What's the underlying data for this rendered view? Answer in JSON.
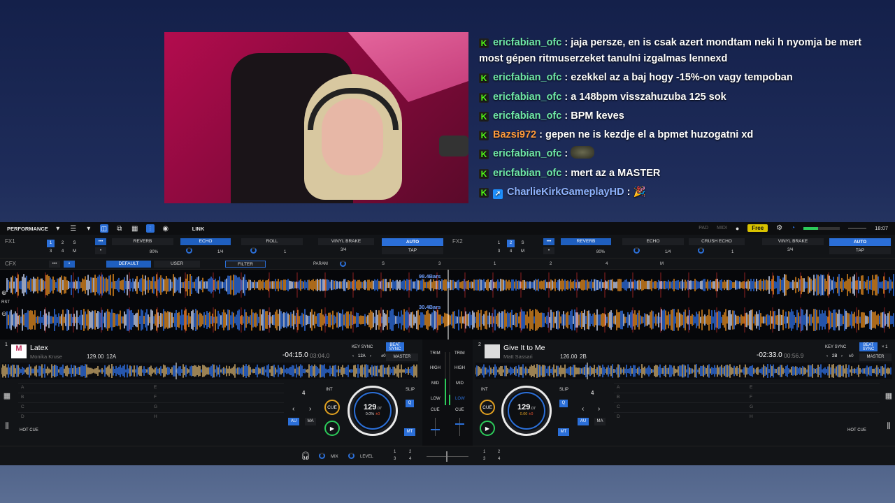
{
  "chat": [
    {
      "user": "ericfabian_ofc",
      "badge": "K",
      "text": "jaja persze, en is csak azert mondtam neki h nyomja be mert most gépen ritmuserzeket tanulni izgalmas lennexd",
      "color": "green"
    },
    {
      "user": "ericfabian_ofc",
      "badge": "K",
      "text": "ezekkel az a baj hogy -15%-on vagy tempoban",
      "color": "green"
    },
    {
      "user": "ericfabian_ofc",
      "badge": "K",
      "text": "a 148bpm visszahuzuba 125 sok",
      "color": "green"
    },
    {
      "user": "ericfabian_ofc",
      "badge": "K",
      "text": "BPM keves",
      "color": "green"
    },
    {
      "user": "Bazsi972",
      "badge": "K",
      "text": "gepen ne is kezdje el a bpmet huzogatni xd",
      "color": "orange"
    },
    {
      "user": "ericfabian_ofc",
      "badge": "K",
      "text": "",
      "color": "green",
      "emote": true
    },
    {
      "user": "ericfabian_ofc",
      "badge": "K",
      "text": "mert az a MASTER",
      "color": "green"
    },
    {
      "user": "CharlieKirkGameplayHD",
      "badge": "K",
      "text": "🎉",
      "color": "blue",
      "badge2": true
    }
  ],
  "topbar": {
    "mode": "PERFORMANCE",
    "link": "LINK",
    "pad": "PAD",
    "midi": "MIDI",
    "free": "Free",
    "clock": "18:07"
  },
  "fx": {
    "fx1": {
      "label": "FX1",
      "nums": [
        "1",
        "2",
        "S",
        "3",
        "4",
        "M"
      ],
      "effects": [
        "REVERB",
        "ECHO",
        "ROLL",
        "VINYL BRAKE"
      ],
      "pct": "80%",
      "beat1": "1/4",
      "beat2": "1",
      "beat3": "3/4",
      "auto": "AUTO",
      "tap": "TAP"
    },
    "fx2": {
      "label": "FX2",
      "nums": [
        "1",
        "2",
        "S",
        "3",
        "4",
        "M"
      ],
      "effects": [
        "REVERB",
        "ECHO",
        "CRUSH ECHO",
        "VINYL BRAKE"
      ],
      "pct": "80%",
      "beat1": "1/4",
      "beat2": "1",
      "beat3": "3/4",
      "auto": "AUTO",
      "tap": "TAP"
    }
  },
  "cfx": {
    "label": "CFX",
    "default": "DEFAULT",
    "user": "USER",
    "filter": "FILTER",
    "param": "PARAM",
    "marks": [
      "S",
      "3",
      "1",
      "2",
      "4",
      "M"
    ]
  },
  "waves": {
    "bars1": "98.4Bars",
    "bars2": "30.4Bars",
    "rst": "RST"
  },
  "deck1": {
    "num": "1",
    "title": "Latex",
    "artist": "Monika Kruse",
    "bpm": "129.00",
    "key": "12A",
    "remain": "-04:15.0",
    "elapsed": "03:04.0",
    "keysync": "KEY SYNC",
    "keyval": "12A",
    "keyoff": "±0",
    "beatsync": "BEAT SYNC",
    "master": "MASTER",
    "jogbpm": "129",
    "jogdec": ".07",
    "jogpct": "0.0%",
    "jogoff": "±0",
    "hotcue": "HOT CUE",
    "loop": "4",
    "int": "INT",
    "cue": "CUE",
    "slip": "SLIP",
    "q": "Q",
    "au": "AU",
    "ma": "MA",
    "mt": "MT",
    "cells": [
      "A",
      "B",
      "C",
      "D",
      "E",
      "F",
      "G",
      "H"
    ]
  },
  "deck2": {
    "num": "2",
    "title": "Give It to Me",
    "artist": "Matt Sassari",
    "bpm": "126.00",
    "key": "2B",
    "remain": "-02:33.0",
    "elapsed": "00:56.9",
    "keysync": "KEY SYNC",
    "keyval": "2B",
    "keyoff": "±0",
    "beatsync": "BEAT SYNC",
    "master": "MASTER",
    "x1": "× 1",
    "jogbpm": "129",
    "jogdec": ".07",
    "jogpct": "0.00",
    "jogoff": "±0",
    "hotcue": "HOT CUE",
    "loop": "4",
    "int": "INT",
    "cue": "CUE",
    "slip": "SLIP",
    "q": "Q",
    "au": "AU",
    "ma": "MA",
    "mt": "MT",
    "cells": [
      "A",
      "B",
      "C",
      "D",
      "E",
      "F",
      "G",
      "H"
    ]
  },
  "mixer": {
    "trim": "TRIM",
    "high": "HIGH",
    "mid": "MID",
    "low": "LOW",
    "cue": "CUE"
  },
  "bottom": {
    "mix": "MIX",
    "level": "LEVEL",
    "n": [
      "1",
      "2",
      "3",
      "4"
    ]
  }
}
